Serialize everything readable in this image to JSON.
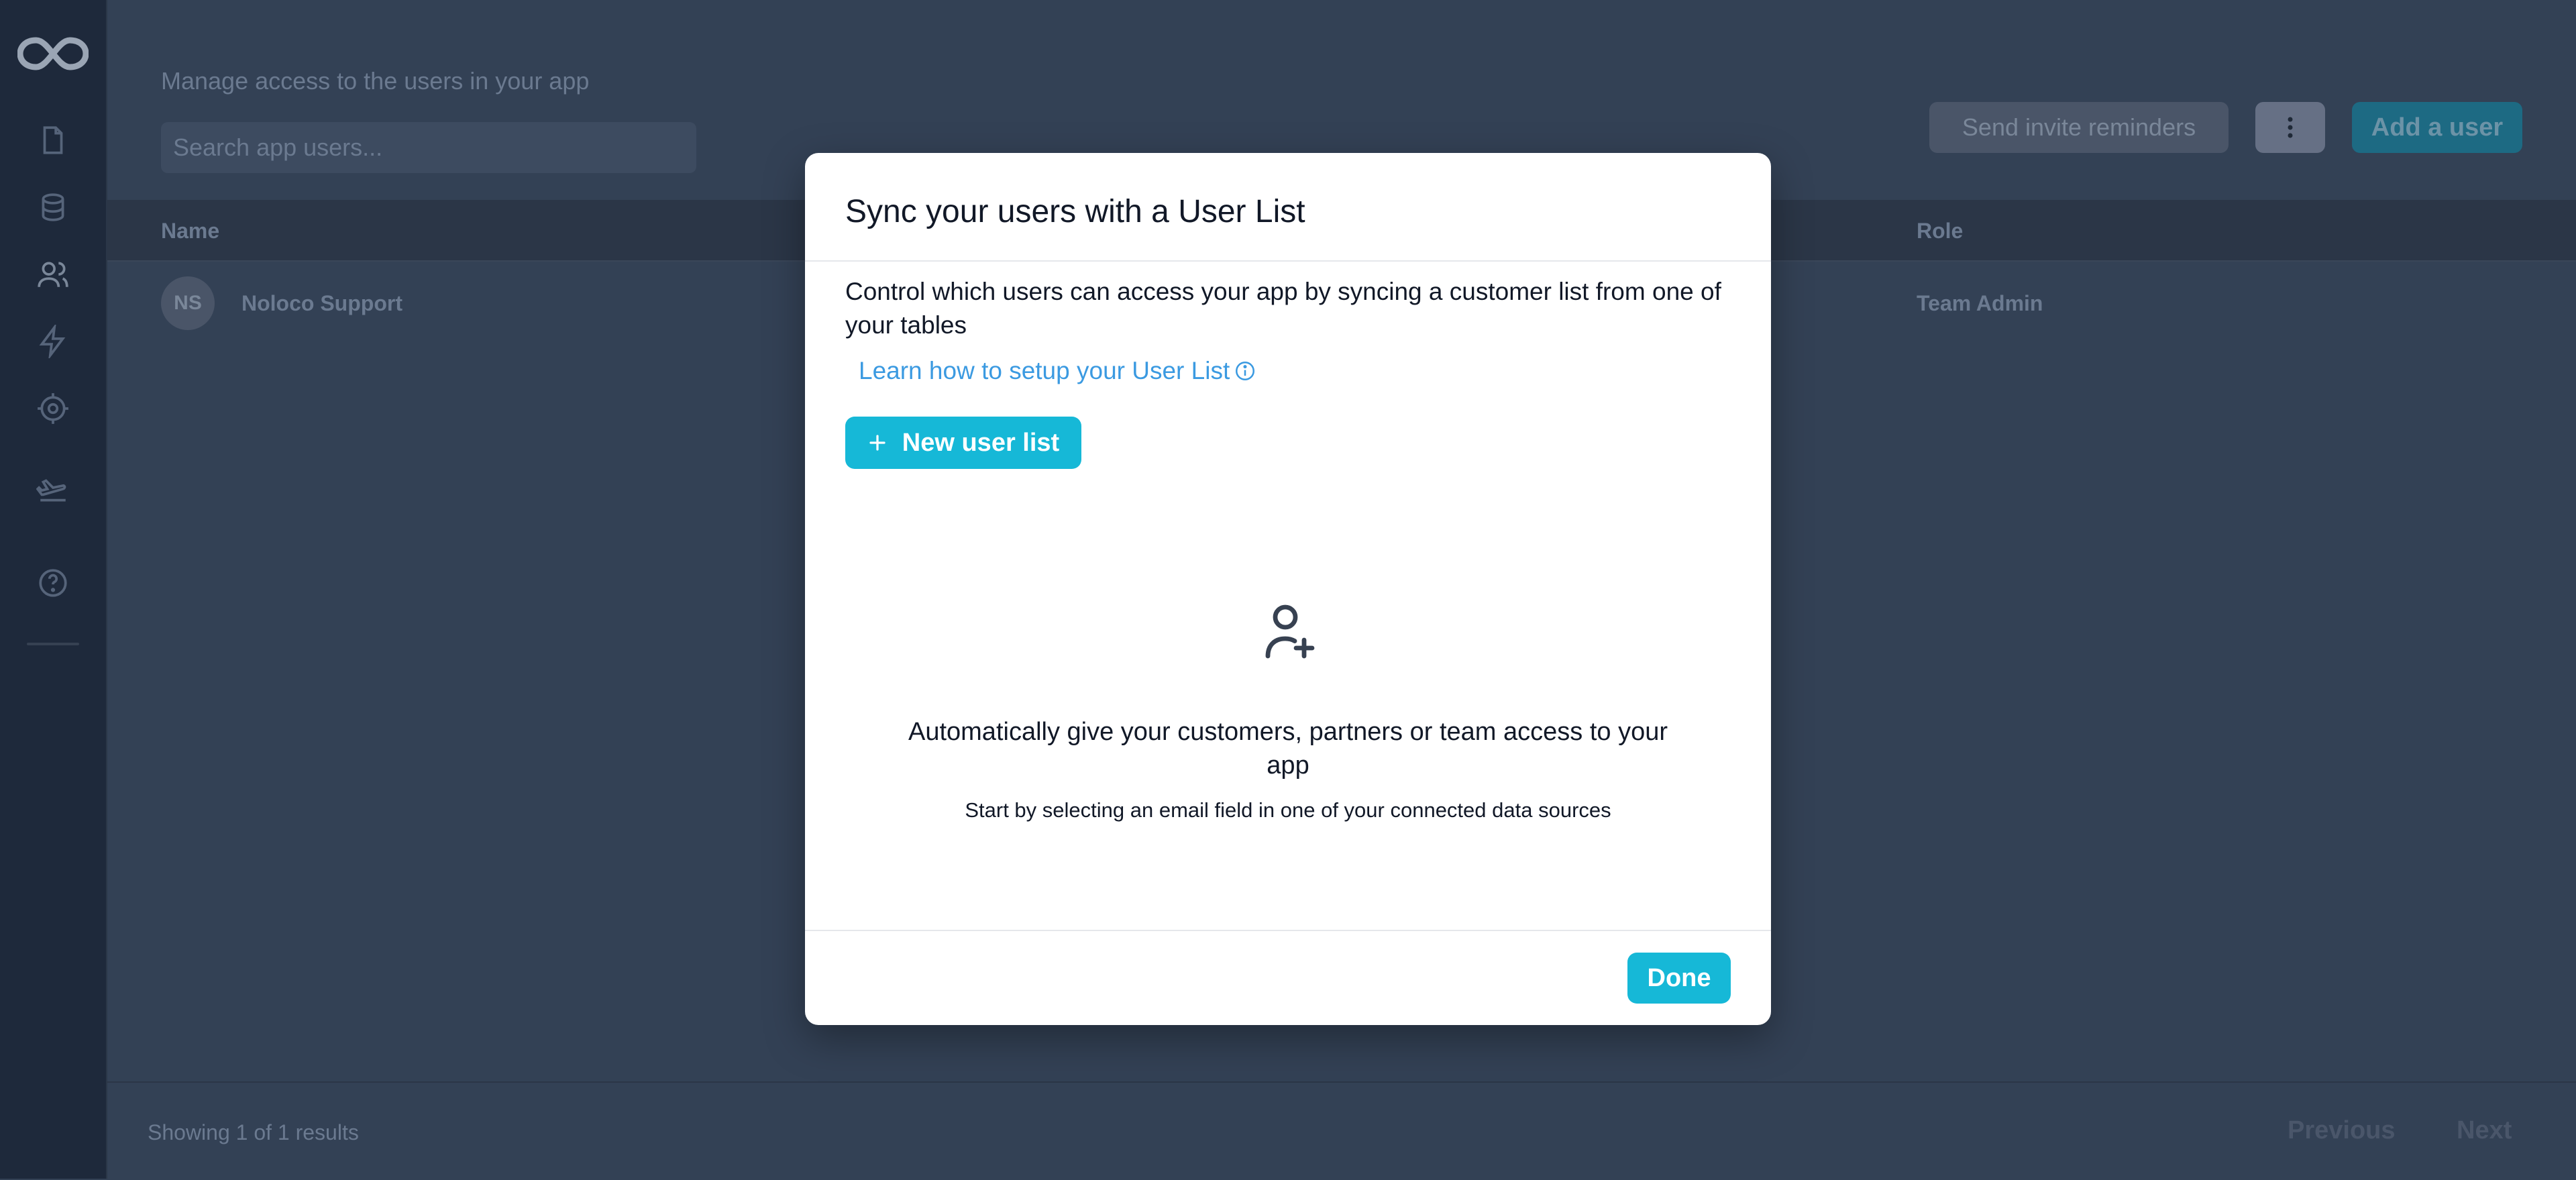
{
  "page": {
    "subtitle": "Manage access to the users in your app",
    "search": {
      "placeholder": "Search app users..."
    },
    "actions": {
      "invite_label": "Send invite reminders",
      "more_icon": "vertical-dots-icon",
      "add_label": "Add a user"
    }
  },
  "sidebar": {
    "logo": "infinity-logo",
    "items": [
      {
        "icon": "page-icon"
      },
      {
        "icon": "database-icon"
      },
      {
        "icon": "users-icon"
      },
      {
        "icon": "lightning-icon"
      },
      {
        "icon": "gear-icon"
      },
      {
        "icon": "launch-icon"
      },
      {
        "icon": "help-icon"
      }
    ]
  },
  "table": {
    "columns": [
      "Name",
      "Role"
    ],
    "rows": [
      {
        "initials": "NS",
        "name": "Noloco Support",
        "role": "Team Admin"
      }
    ]
  },
  "footer": {
    "showing": "Showing 1 of 1 results",
    "previous": "Previous",
    "next": "Next"
  },
  "modal": {
    "title": "Sync your users with a User List",
    "description": "Control which users can access your app by syncing a customer list from one of your tables",
    "learn_link": "Learn how to setup your User List",
    "new_button": "New user list",
    "empty_title": "Automatically give your customers, partners or team access to your app",
    "empty_subtitle": "Start by selecting an email field in one of your connected data sources",
    "done_button": "Done"
  },
  "colors": {
    "accent": "#16b8d7",
    "link": "#3b9ae1",
    "backdrop": "#334155",
    "sidebar": "#1e293b"
  }
}
